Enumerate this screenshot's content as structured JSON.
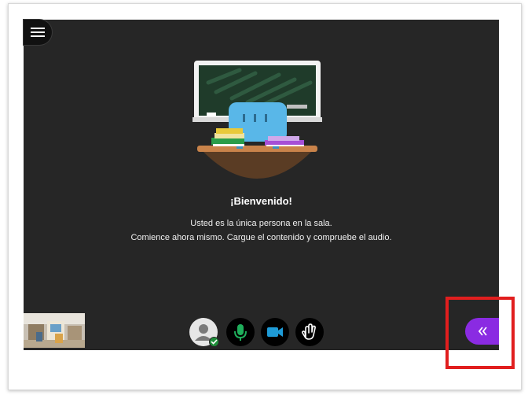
{
  "welcome": {
    "title": "¡Bienvenido!",
    "line1": "Usted es la única persona en la sala.",
    "line2": "Comience ahora mismo. Cargue el contenido y compruebe el audio."
  },
  "controls": {
    "menu_icon": "hamburger-menu-icon",
    "avatar_icon": "user-avatar-icon",
    "mic_icon": "microphone-icon",
    "camera_icon": "video-camera-icon",
    "hand_icon": "raise-hand-icon",
    "panel_icon": "double-chevron-left-icon"
  },
  "colors": {
    "stage_bg": "#262626",
    "accent_purple": "#8a2be2",
    "mic_green": "#1fae5b",
    "camera_blue": "#1e9bd7",
    "highlight_red": "#e11e1e"
  }
}
